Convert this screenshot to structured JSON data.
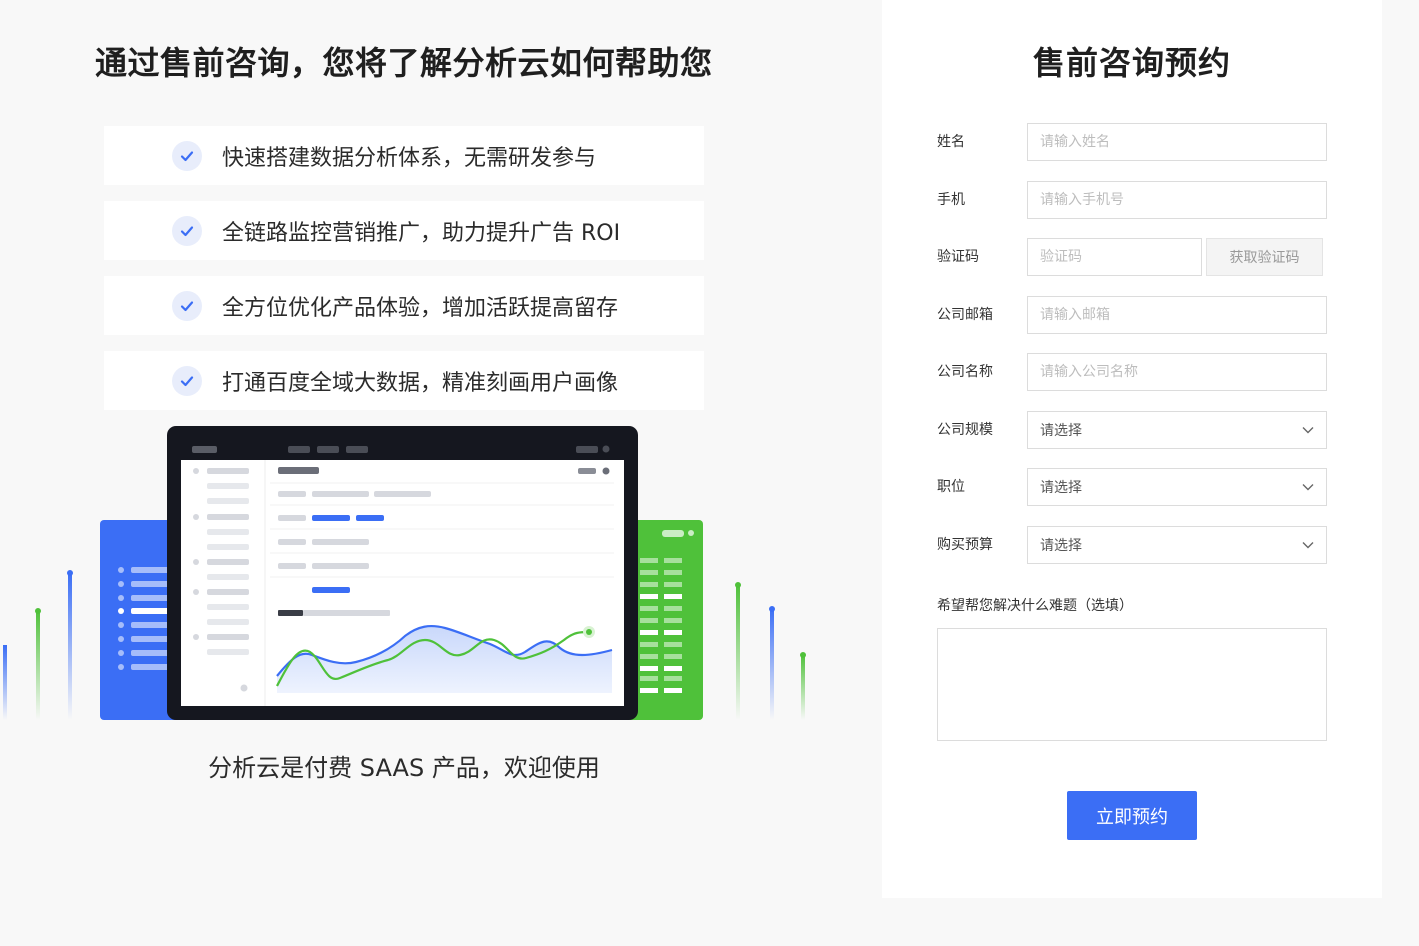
{
  "left": {
    "headline": "通过售前咨询，您将了解分析云如何帮助您",
    "benefits": [
      "快速搭建数据分析体系，无需研发参与",
      "全链路监控营销推广，助力提升广告 ROI",
      "全方位优化产品体验，增加活跃提高留存",
      "打通百度全域大数据，精准刻画用户画像"
    ],
    "tagline": "分析云是付费 SAAS 产品，欢迎使用"
  },
  "form": {
    "title": "售前咨询预约",
    "name": {
      "label": "姓名",
      "placeholder": "请输入姓名"
    },
    "phone": {
      "label": "手机",
      "placeholder": "请输入手机号"
    },
    "code": {
      "label": "验证码",
      "placeholder": "验证码",
      "button": "获取验证码"
    },
    "email": {
      "label": "公司邮箱",
      "placeholder": "请输入邮箱"
    },
    "company": {
      "label": "公司名称",
      "placeholder": "请输入公司名称"
    },
    "size": {
      "label": "公司规模",
      "value": "请选择"
    },
    "position": {
      "label": "职位",
      "value": "请选择"
    },
    "budget": {
      "label": "购买预算",
      "value": "请选择"
    },
    "problem": {
      "label": "希望帮您解决什么难题（选填）"
    },
    "submit": "立即预约"
  },
  "colors": {
    "accent": "#3b6ef5",
    "green": "#4fc13a",
    "dark": "#15171f"
  }
}
